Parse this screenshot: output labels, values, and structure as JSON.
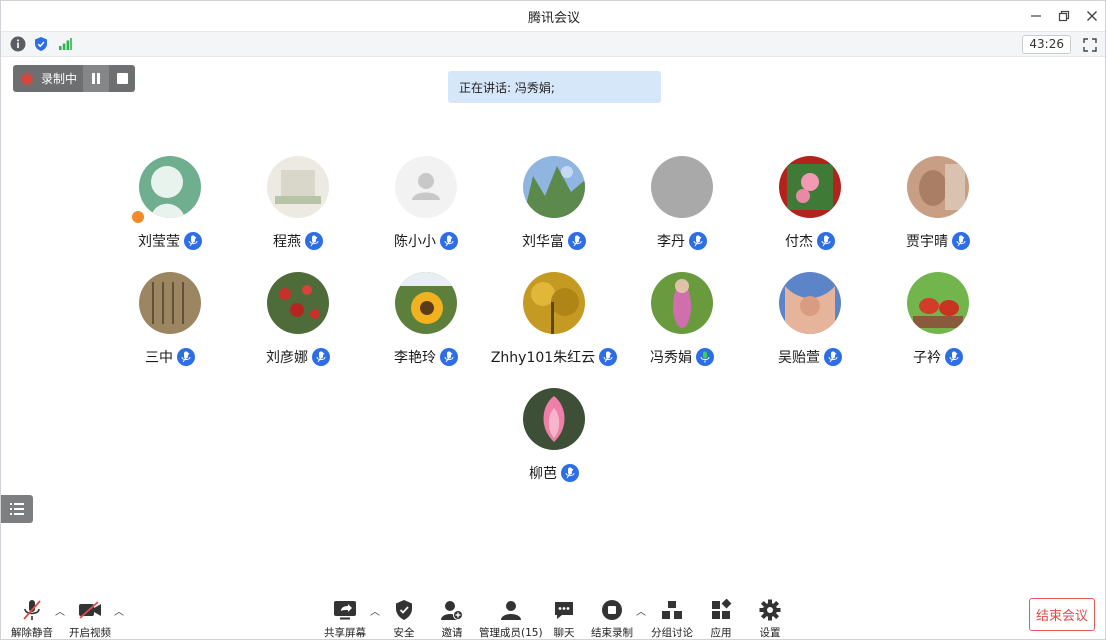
{
  "window": {
    "title": "腾讯会议"
  },
  "window_controls": {
    "minimize_icon": "minimize-icon",
    "restore_icon": "restore-icon",
    "close_icon": "close-icon"
  },
  "info_bar": {
    "icons": [
      "info-icon",
      "shield-icon",
      "signal-icon"
    ],
    "timer": "43:26",
    "fullscreen_icon": "fullscreen-icon"
  },
  "recording": {
    "label": "录制中"
  },
  "speaking_banner": {
    "text": "正在讲话: 冯秀娟;"
  },
  "participants": [
    {
      "name": "刘莹莹",
      "host": true
    },
    {
      "name": "程燕"
    },
    {
      "name": "陈小小"
    },
    {
      "name": "刘华富"
    },
    {
      "name": "李丹"
    },
    {
      "name": "付杰"
    },
    {
      "name": "贾宇晴"
    },
    {
      "name": "三中"
    },
    {
      "name": "刘彦娜"
    },
    {
      "name": "李艳玲"
    },
    {
      "name": "Zhhy101朱红云"
    },
    {
      "name": "冯秀娟",
      "speaking": true
    },
    {
      "name": "吴贻萱"
    },
    {
      "name": "子衿"
    },
    {
      "name": "柳芭"
    }
  ],
  "toolbar": {
    "unmute": "解除静音",
    "start_video": "开启视频",
    "share_screen": "共享屏幕",
    "security": "安全",
    "invite": "邀请",
    "manage_members": "管理成员(15)",
    "chat": "聊天",
    "end_recording": "结束录制",
    "breakout": "分组讨论",
    "apps": "应用",
    "settings": "设置",
    "end_meeting": "结束会议"
  },
  "colors": {
    "accent": "#2d6ee6",
    "recording": "#d9453b",
    "end_meeting": "#e24b48",
    "speaking_bg": "#d6e7fa",
    "host_badge": "#f08a2a"
  }
}
